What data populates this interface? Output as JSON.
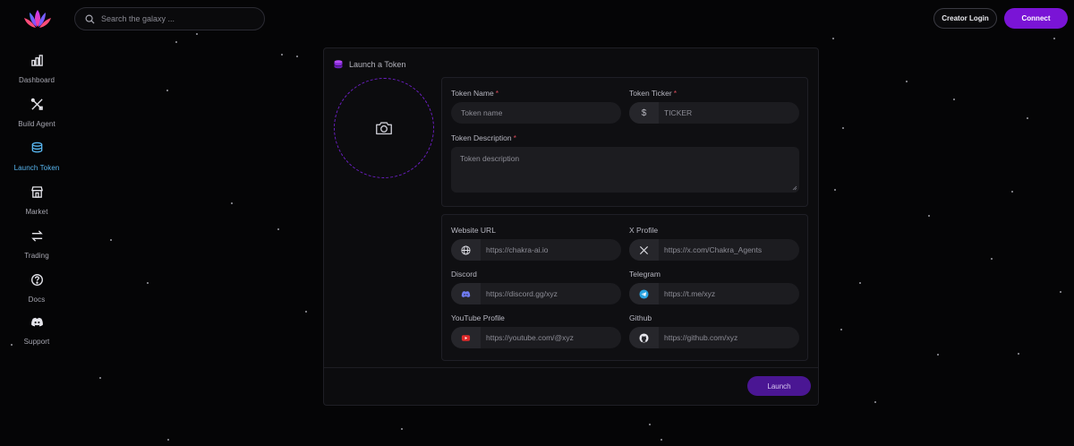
{
  "search": {
    "placeholder": "Search the galaxy ..."
  },
  "header": {
    "creator_login": "Creator Login",
    "connect": "Connect"
  },
  "sidebar": {
    "items": [
      {
        "label": "Dashboard",
        "icon": "bar-chart-icon",
        "active": false
      },
      {
        "label": "Build Agent",
        "icon": "tools-icon",
        "active": false
      },
      {
        "label": "Launch Token",
        "icon": "coins-icon",
        "active": true
      },
      {
        "label": "Market",
        "icon": "store-icon",
        "active": false
      },
      {
        "label": "Trading",
        "icon": "swap-arrows-icon",
        "active": false
      },
      {
        "label": "Docs",
        "icon": "help-circle-icon",
        "active": false
      },
      {
        "label": "Support",
        "icon": "discord-icon",
        "active": false
      }
    ],
    "active_color": "#58b6f0"
  },
  "card": {
    "title": "Launch a Token",
    "token_name": {
      "label": "Token Name",
      "required_mark": "*",
      "placeholder": "Token name",
      "value": ""
    },
    "token_ticker": {
      "label": "Token Ticker",
      "required_mark": "*",
      "prefix": "$",
      "placeholder": "TICKER",
      "value": ""
    },
    "token_description": {
      "label": "Token Description",
      "required_mark": "*",
      "placeholder": "Token description",
      "value": ""
    },
    "website": {
      "label": "Website URL",
      "placeholder": "https://chakra-ai.io",
      "icon": "globe-icon"
    },
    "x_profile": {
      "label": "X Profile",
      "placeholder": "https://x.com/Chakra_Agents",
      "icon": "x-logo-icon"
    },
    "discord": {
      "label": "Discord",
      "placeholder": "https://discord.gg/xyz",
      "icon": "discord-icon"
    },
    "telegram": {
      "label": "Telegram",
      "placeholder": "https://t.me/xyz",
      "icon": "telegram-icon"
    },
    "youtube": {
      "label": "YouTube Profile",
      "placeholder": "https://youtube.com/@xyz",
      "icon": "youtube-icon"
    },
    "github": {
      "label": "Github",
      "placeholder": "https://github.com/xyz",
      "icon": "github-icon"
    },
    "launch_button": "Launch"
  },
  "colors": {
    "accent": "#7a14d6",
    "launch_button": "#4a1693",
    "required": "#d84a5a",
    "background": "#050506"
  }
}
